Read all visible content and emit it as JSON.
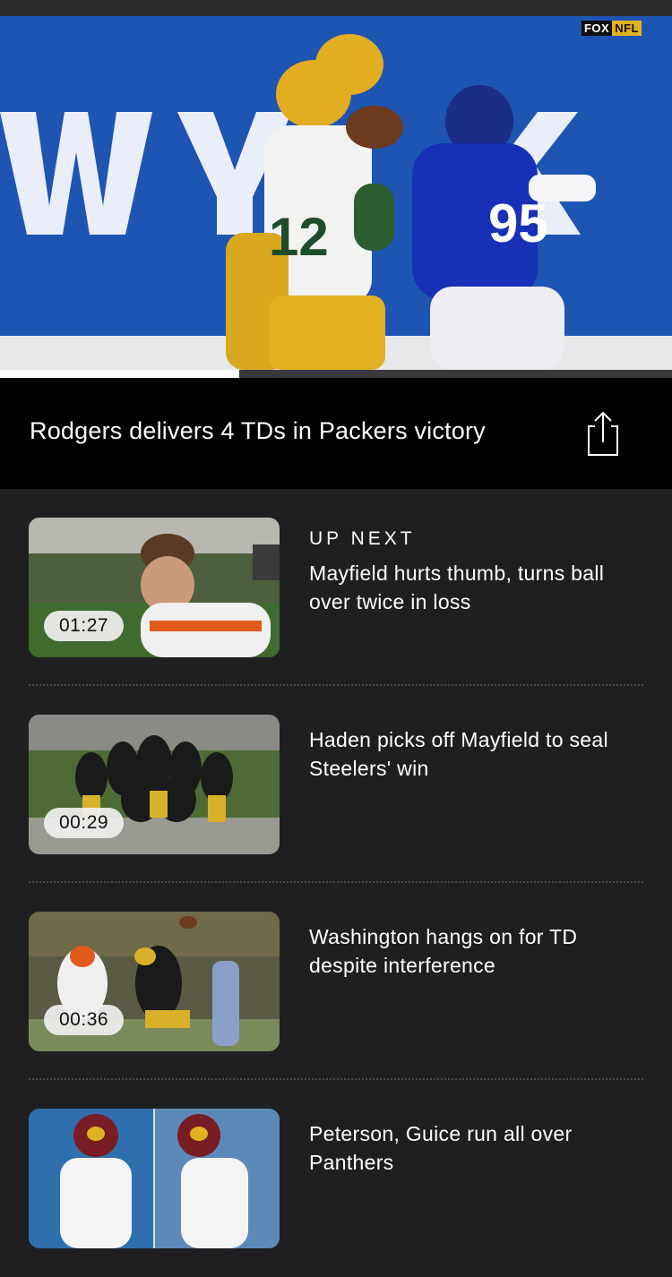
{
  "player": {
    "broadcast_logo": {
      "fox": "FOX",
      "nfl": "NFL"
    },
    "progress": 0.356
  },
  "current": {
    "title": "Rodgers delivers 4 TDs in Packers victory",
    "share_icon": "share-icon"
  },
  "up_next_label": "UP NEXT",
  "videos": [
    {
      "title": "Mayfield hurts thumb, turns ball over twice in loss",
      "duration": "01:27"
    },
    {
      "title": "Haden picks off Mayfield to seal Steelers' win",
      "duration": "00:29"
    },
    {
      "title": "Washington hangs on for TD despite interference",
      "duration": "00:36"
    },
    {
      "title": "Peterson, Guice run all over Panthers",
      "duration": ""
    }
  ],
  "colors": {
    "background": "#1f1f21",
    "title_bar": "#000000",
    "divider": "#4a4a4c"
  }
}
